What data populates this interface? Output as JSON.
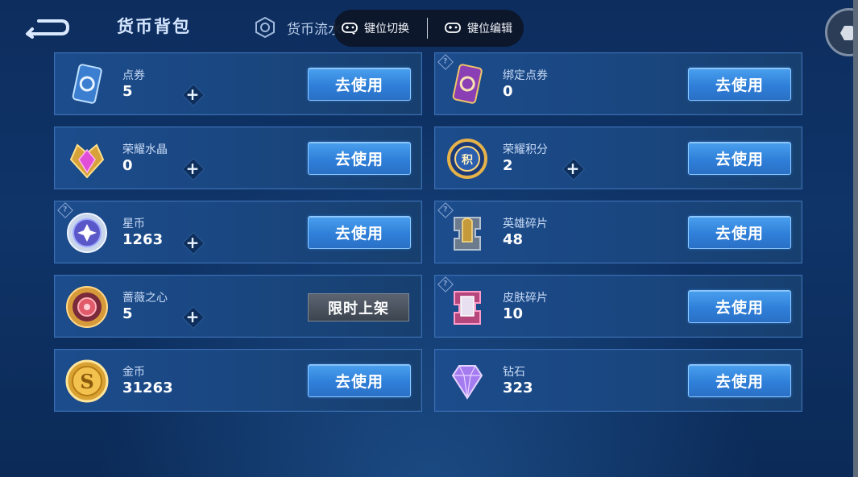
{
  "header": {
    "title": "货币背包",
    "tab_label": "货币流水",
    "back_icon": "back-arrow-icon"
  },
  "keybar": {
    "switch_label": "键位切换",
    "edit_label": "键位编辑"
  },
  "currencies": [
    {
      "name": "点券",
      "value": "5",
      "button": "去使用",
      "has_plus": true,
      "has_help": false,
      "icon": "coupon-card-icon"
    },
    {
      "name": "绑定点券",
      "value": "0",
      "button": "去使用",
      "has_plus": false,
      "has_help": true,
      "icon": "bound-coupon-card-icon"
    },
    {
      "name": "荣耀水晶",
      "value": "0",
      "button": "去使用",
      "has_plus": true,
      "has_help": false,
      "icon": "glory-crystal-icon"
    },
    {
      "name": "荣耀积分",
      "value": "2",
      "button": "去使用",
      "has_plus": true,
      "has_help": false,
      "icon": "glory-points-icon"
    },
    {
      "name": "星币",
      "value": "1263",
      "button": "去使用",
      "has_plus": true,
      "has_help": true,
      "icon": "star-coin-icon"
    },
    {
      "name": "英雄碎片",
      "value": "48",
      "button": "去使用",
      "has_plus": false,
      "has_help": true,
      "icon": "hero-fragment-icon"
    },
    {
      "name": "蔷薇之心",
      "value": "5",
      "button": "限时上架",
      "has_plus": true,
      "has_help": false,
      "icon": "rose-heart-icon"
    },
    {
      "name": "皮肤碎片",
      "value": "10",
      "button": "去使用",
      "has_plus": false,
      "has_help": true,
      "icon": "skin-fragment-icon"
    },
    {
      "name": "金币",
      "value": "31263",
      "button": "去使用",
      "has_plus": false,
      "has_help": false,
      "icon": "gold-coin-icon"
    },
    {
      "name": "钻石",
      "value": "323",
      "button": "去使用",
      "has_plus": false,
      "has_help": false,
      "icon": "diamond-icon"
    }
  ],
  "help_glyph": "?",
  "plus_glyph": "+"
}
